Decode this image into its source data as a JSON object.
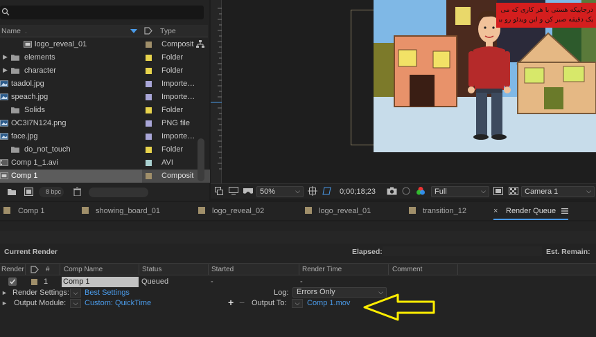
{
  "project": {
    "columns": {
      "name": "Name",
      "type": "Type"
    },
    "items": [
      {
        "name": "logo_reveal_01",
        "type": "Composit",
        "kind": "comp",
        "label_color": "#a08f6a",
        "indent": true
      },
      {
        "name": "elements",
        "type": "Folder",
        "kind": "folder",
        "label_color": "#e8d44d",
        "expandable": true
      },
      {
        "name": "character",
        "type": "Folder",
        "kind": "folder",
        "label_color": "#e8d44d",
        "expandable": true
      },
      {
        "name": "taadol.jpg",
        "type": "Importe…C",
        "kind": "image",
        "label_color": "#a9a6d8"
      },
      {
        "name": "speach.jpg",
        "type": "Importe…C",
        "kind": "image",
        "label_color": "#a9a6d8"
      },
      {
        "name": "Solids",
        "type": "Folder",
        "kind": "folder",
        "label_color": "#e8d44d"
      },
      {
        "name": "OC3I7N124.png",
        "type": "PNG file",
        "kind": "image",
        "label_color": "#a9a6d8"
      },
      {
        "name": "face.jpg",
        "type": "Importe…C",
        "kind": "image",
        "label_color": "#a9a6d8"
      },
      {
        "name": "do_not_touch",
        "type": "Folder",
        "kind": "folder",
        "label_color": "#e8d44d"
      },
      {
        "name": "Comp 1_1.avi",
        "type": "AVI",
        "kind": "video",
        "label_color": "#a9d0d0"
      },
      {
        "name": "Comp 1",
        "type": "Composit",
        "kind": "comp",
        "label_color": "#a08f6a",
        "selected": true
      }
    ],
    "bpc": "8 bpc"
  },
  "viewer": {
    "zoom": "50%",
    "timecode": "0;00;18;23",
    "resolution": "Full",
    "camera": "Camera 1",
    "persian_caption_line1": "درجاییکه هستی با هر کاری که می کنی",
    "persian_caption_line2": "یک دقیقه صبر کن و این ویدئو رو ببین"
  },
  "tabs": [
    {
      "label": "Comp 1"
    },
    {
      "label": "showing_board_01"
    },
    {
      "label": "logo_reveal_02"
    },
    {
      "label": "logo_reveal_01"
    },
    {
      "label": "transition_12"
    },
    {
      "label": "Render Queue",
      "active": true
    }
  ],
  "render_queue": {
    "current_render": "Current Render",
    "elapsed": "Elapsed:",
    "est_remain": "Est. Remain:",
    "columns": {
      "render": "Render",
      "num": "#",
      "comp_name": "Comp Name",
      "status": "Status",
      "started": "Started",
      "render_time": "Render Time",
      "comment": "Comment"
    },
    "item": {
      "num": "1",
      "comp_name": "Comp 1",
      "status": "Queued",
      "started": "-",
      "render_time": "-"
    },
    "render_settings_label": "Render Settings:",
    "render_settings_value": "Best Settings",
    "log_label": "Log:",
    "log_value": "Errors Only",
    "output_module_label": "Output Module:",
    "output_module_value": "Custom: QuickTime",
    "output_to_label": "Output To:",
    "output_to_value": "Comp 1.mov"
  },
  "colors": {
    "accent_blue": "#4a9ae8",
    "arrow_yellow": "#ffee00",
    "comp_label": "#a08f6a",
    "folder_label": "#e8d44d"
  }
}
